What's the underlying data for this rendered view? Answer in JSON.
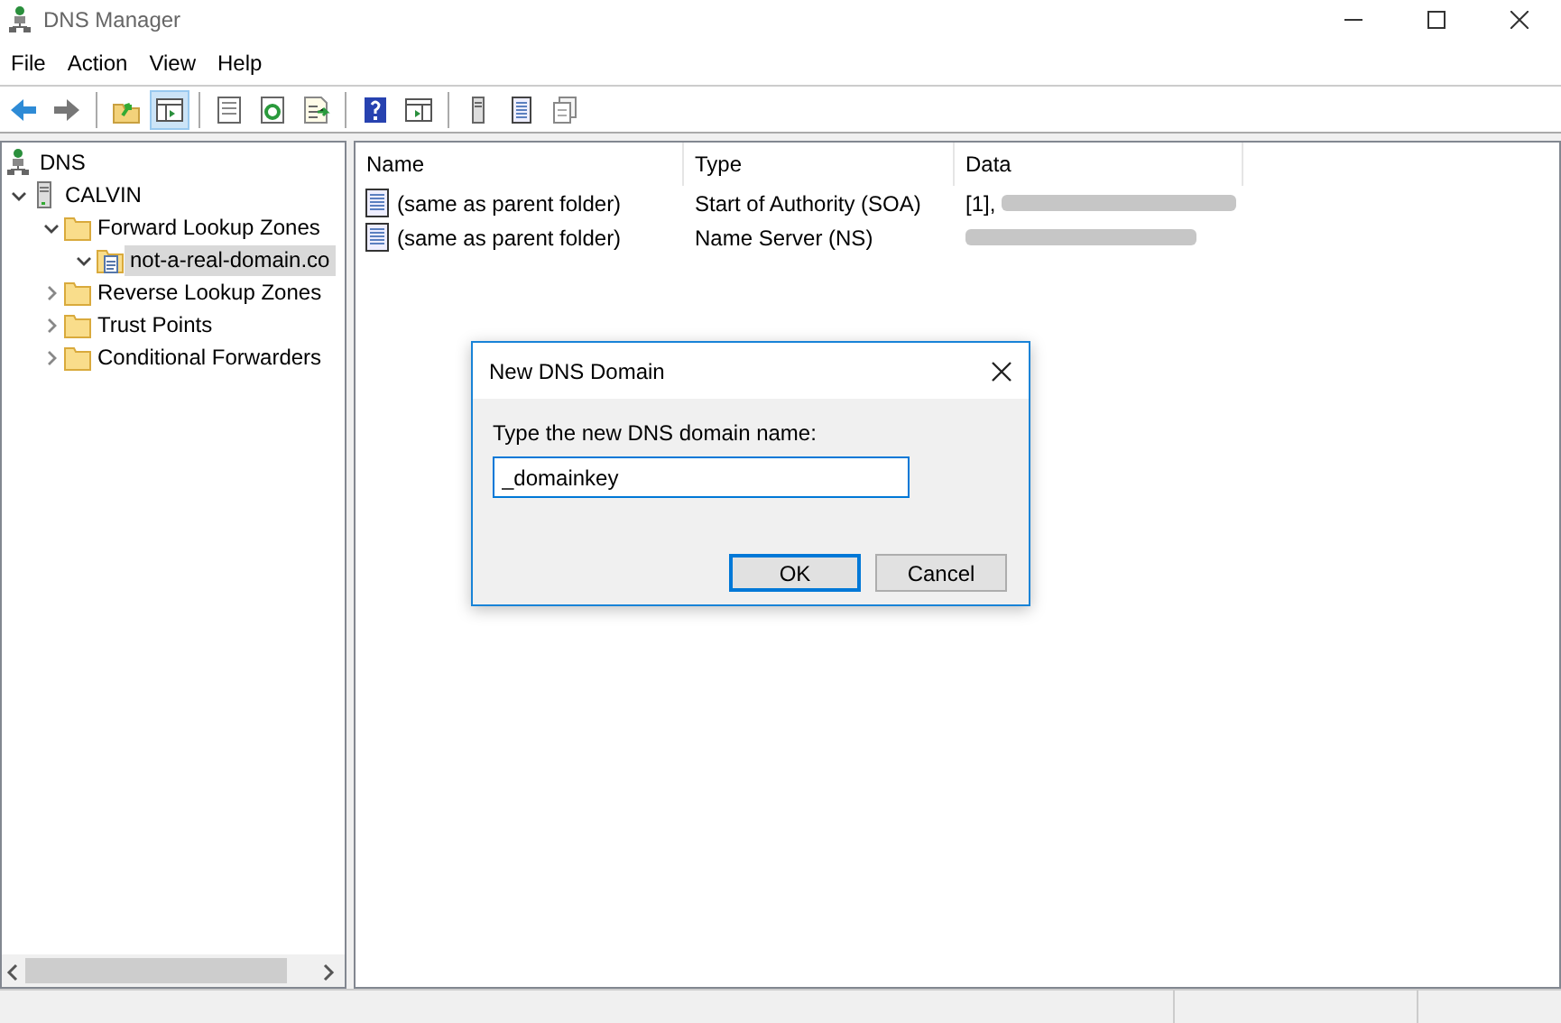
{
  "window": {
    "title": "DNS Manager"
  },
  "menu": [
    "File",
    "Action",
    "View",
    "Help"
  ],
  "toolbar": [
    {
      "kind": "back",
      "pressed": false
    },
    {
      "kind": "forward",
      "pressed": false
    },
    {
      "kind": "sep"
    },
    {
      "kind": "up",
      "pressed": false
    },
    {
      "kind": "tree",
      "pressed": true
    },
    {
      "kind": "sep"
    },
    {
      "kind": "props",
      "pressed": false
    },
    {
      "kind": "refresh",
      "pressed": false
    },
    {
      "kind": "export",
      "pressed": false
    },
    {
      "kind": "sep"
    },
    {
      "kind": "help",
      "pressed": false
    },
    {
      "kind": "pane",
      "pressed": false
    },
    {
      "kind": "sep"
    },
    {
      "kind": "server",
      "pressed": false
    },
    {
      "kind": "record",
      "pressed": false
    },
    {
      "kind": "copy",
      "pressed": false
    }
  ],
  "tree": [
    {
      "label": "DNS",
      "kind": "dns",
      "children": [
        {
          "label": "CALVIN",
          "kind": "server",
          "expanded": true,
          "selected": false,
          "children": [
            {
              "label": "Forward Lookup Zones",
              "kind": "folder",
              "expanded": true,
              "selected": false,
              "children": [
                {
                  "label": "not-a-real-domain.co",
                  "kind": "zone",
                  "expanded": true,
                  "selected": true
                }
              ]
            },
            {
              "label": "Reverse Lookup Zones",
              "kind": "folder",
              "expanded": false,
              "selected": false
            },
            {
              "label": "Trust Points",
              "kind": "folder",
              "expanded": false,
              "selected": false
            },
            {
              "label": "Conditional Forwarders",
              "kind": "folder",
              "expanded": false,
              "selected": false
            }
          ]
        }
      ]
    }
  ],
  "table": {
    "columns": [
      "Name",
      "Type",
      "Data"
    ],
    "rows": [
      {
        "name": "(same as parent folder)",
        "type": "Start of Authority (SOA)",
        "data": "[1],"
      },
      {
        "name": "(same as parent folder)",
        "type": "Name Server (NS)",
        "data": ""
      }
    ]
  },
  "dialog": {
    "title": "New DNS Domain",
    "label": "Type the new DNS domain name:",
    "value": "_domainkey",
    "buttons": [
      {
        "label": "OK",
        "default": true
      },
      {
        "label": "Cancel",
        "default": false
      }
    ]
  }
}
